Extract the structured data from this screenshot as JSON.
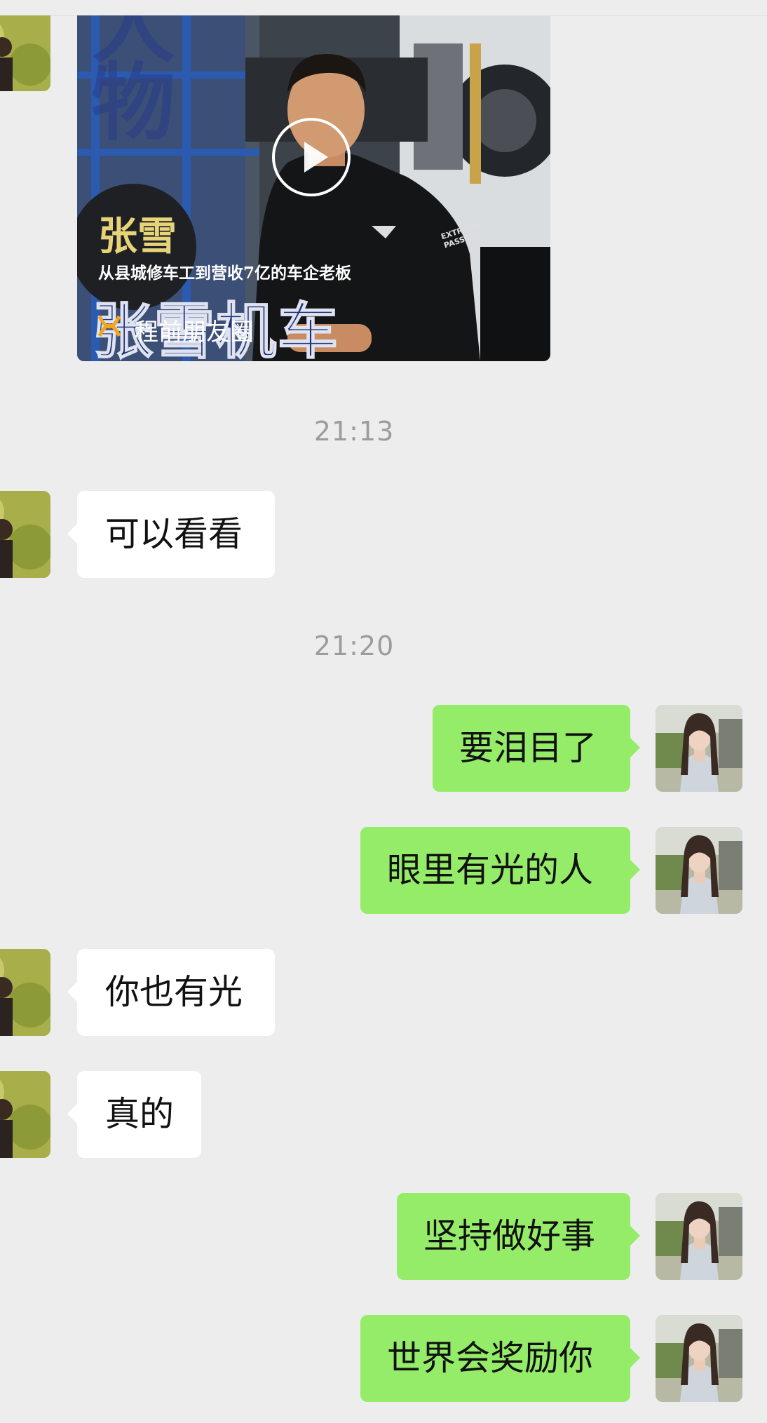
{
  "video_card": {
    "overlay_big": "人物",
    "person_name": "张雪",
    "subtitle": "从县城修车工到营收7亿的车企老板",
    "brand_big": "张雪机车",
    "shirt_text": "EXTREME PASSION",
    "channel": "程前朋友圈",
    "play_icon": "play-icon",
    "channel_icon": "channel-logo-icon"
  },
  "messages": [
    {
      "type": "time",
      "text": "21:13"
    },
    {
      "type": "in",
      "text": "可以看看"
    },
    {
      "type": "time",
      "text": "21:20"
    },
    {
      "type": "out",
      "text": "要泪目了"
    },
    {
      "type": "out",
      "text": "眼里有光的人"
    },
    {
      "type": "in",
      "text": "你也有光"
    },
    {
      "type": "in",
      "text": "真的"
    },
    {
      "type": "out",
      "text": "坚持做好事"
    },
    {
      "type": "out",
      "text": "世界会奖励你"
    }
  ],
  "colors": {
    "background": "#ededed",
    "out_bubble": "#95ec69",
    "in_bubble": "#ffffff",
    "timestamp": "#9c9c9c",
    "name_yellow": "#e6d37a",
    "brand_blue": "#1f2f7a"
  }
}
